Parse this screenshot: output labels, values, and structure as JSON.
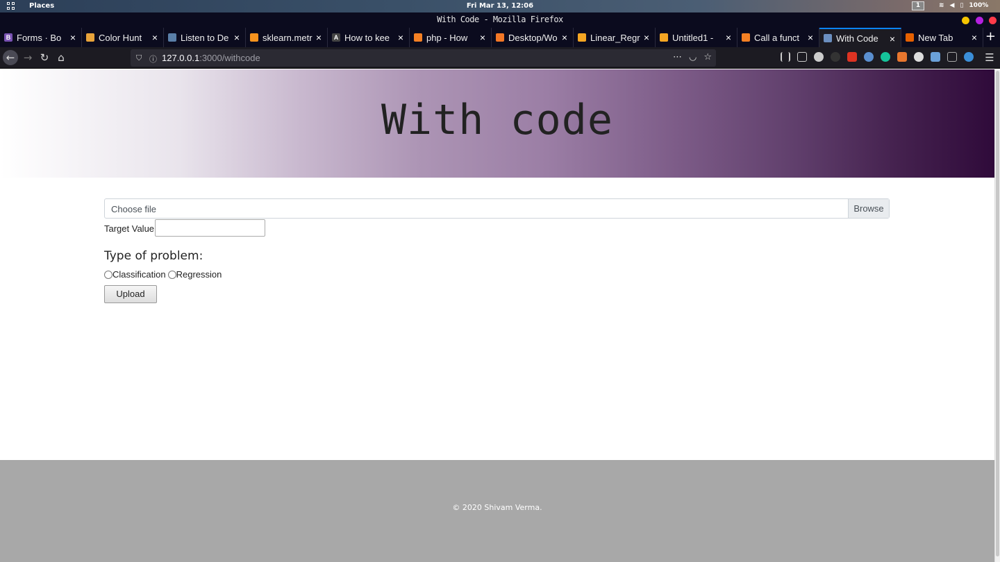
{
  "system": {
    "places": "Places",
    "clock": "Fri Mar 13, 12:06",
    "workspace": "1",
    "battery": "100%"
  },
  "window": {
    "title": "With Code - Mozilla Firefox"
  },
  "tabs": [
    {
      "label": "Forms · Bo",
      "icon": "bootstrap-icon",
      "color": "#7952b3",
      "glyph": "B"
    },
    {
      "label": "Color Hunt",
      "icon": "color-hunt-icon",
      "color": "#e8a33a",
      "glyph": ""
    },
    {
      "label": "Listen to De",
      "icon": "listen-icon",
      "color": "#5a7fa8",
      "glyph": ""
    },
    {
      "label": "sklearn.metr",
      "icon": "sklearn-icon",
      "color": "#f7931e",
      "glyph": ""
    },
    {
      "label": "How to kee",
      "icon": "hashnode-icon",
      "color": "#444",
      "glyph": "A"
    },
    {
      "label": "php - How",
      "icon": "stackoverflow-icon",
      "color": "#f48024",
      "glyph": ""
    },
    {
      "label": "Desktop/Wo",
      "icon": "jupyter-icon",
      "color": "#f37726",
      "glyph": ""
    },
    {
      "label": "Linear_Regr",
      "icon": "notebook-icon",
      "color": "#f5a623",
      "glyph": ""
    },
    {
      "label": "Untitled1 -",
      "icon": "notebook-icon",
      "color": "#f5a623",
      "glyph": ""
    },
    {
      "label": "Call a funct",
      "icon": "stackoverflow-icon",
      "color": "#f48024",
      "glyph": ""
    },
    {
      "label": "With Code",
      "icon": "page-icon",
      "color": "#6b8fbf",
      "glyph": "",
      "active": true
    },
    {
      "label": "New Tab",
      "icon": "firefox-icon",
      "color": "#e66000",
      "glyph": ""
    }
  ],
  "address": {
    "host": "127.0.0.1",
    "path": ":3000/withcode"
  },
  "page": {
    "heading": "With code",
    "file_placeholder": "Choose file",
    "browse_label": "Browse",
    "target_label": "Target Value:",
    "target_value": "",
    "problem_title": "Type of problem:",
    "option_classification": "Classification",
    "option_regression": "Regression",
    "upload_label": "Upload",
    "footer": "© 2020 Shivam Verma."
  }
}
